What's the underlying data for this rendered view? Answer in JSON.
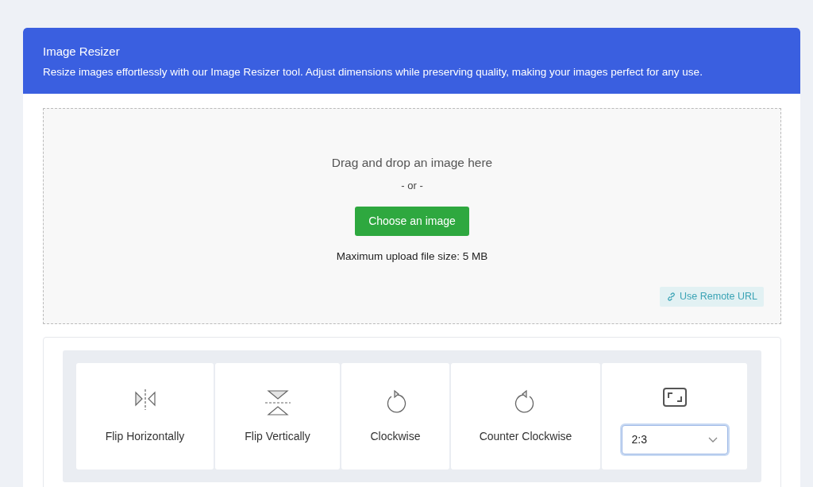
{
  "header": {
    "title": "Image Resizer",
    "subtitle": "Resize images effortlessly with our Image Resizer tool. Adjust dimensions while preserving quality, making your images perfect for any use."
  },
  "dropzone": {
    "prompt": "Drag and drop an image here",
    "separator": "- or -",
    "button": "Choose an image",
    "limit": "Maximum upload file size: 5 MB",
    "remote_link": "Use Remote URL"
  },
  "tools": [
    {
      "kind": "fliph",
      "label": "Flip Horizontally"
    },
    {
      "kind": "flipv",
      "label": "Flip Vertically"
    },
    {
      "kind": "cw",
      "label": "Clockwise"
    },
    {
      "kind": "ccw",
      "label": "Counter Clockwise"
    },
    {
      "kind": "ratio",
      "value": "2:3",
      "focused": true
    }
  ]
}
